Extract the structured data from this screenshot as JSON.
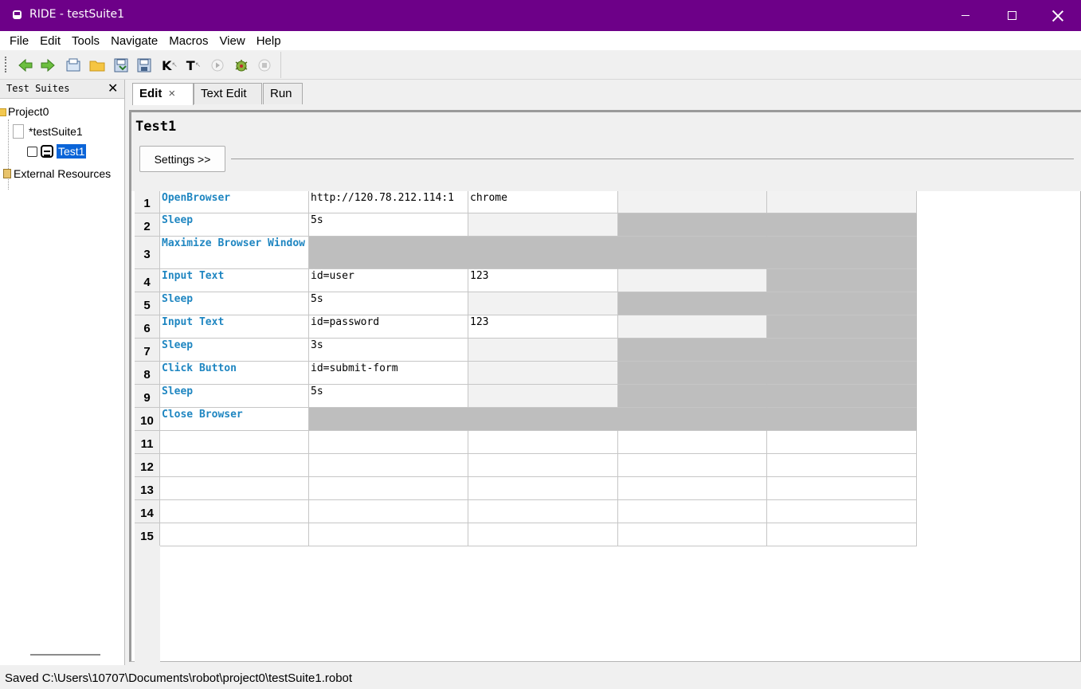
{
  "window": {
    "title": "RIDE - testSuite1"
  },
  "menu": [
    "File",
    "Edit",
    "Tools",
    "Navigate",
    "Macros",
    "View",
    "Help"
  ],
  "toolbar": {
    "k_label": "K",
    "t_label": "T"
  },
  "left_panel": {
    "header": "Test Suites",
    "close": "✕",
    "project": "Project0",
    "suite": "*testSuite1",
    "test": "Test1",
    "external": "External Resources"
  },
  "tabs": {
    "edit": "Edit",
    "edit_close": "×",
    "text_edit": "Text Edit",
    "run": "Run"
  },
  "editor": {
    "title": "Test1",
    "settings_button": "Settings >>"
  },
  "grid": {
    "rows": [
      {
        "num": "1",
        "keyword": "OpenBrowser",
        "args": [
          "http://120.78.212.114:1",
          "chrome",
          "",
          ""
        ],
        "shade": [
          "empty",
          "empty",
          "light",
          "light"
        ]
      },
      {
        "num": "2",
        "keyword": "Sleep",
        "args": [
          "5s",
          "",
          "",
          ""
        ],
        "shade": [
          "empty",
          "light",
          "dark",
          "dark"
        ]
      },
      {
        "num": "3",
        "keyword": "Maximize Browser Window",
        "args": [
          "",
          "",
          "",
          ""
        ],
        "shade": [
          "dark",
          "dark",
          "dark",
          "dark"
        ]
      },
      {
        "num": "4",
        "keyword": "Input Text",
        "args": [
          "id=user",
          "123",
          "",
          ""
        ],
        "shade": [
          "empty",
          "empty",
          "light",
          "dark"
        ]
      },
      {
        "num": "5",
        "keyword": "Sleep",
        "args": [
          "5s",
          "",
          "",
          ""
        ],
        "shade": [
          "empty",
          "light",
          "dark",
          "dark"
        ]
      },
      {
        "num": "6",
        "keyword": "Input Text",
        "args": [
          "id=password",
          "123",
          "",
          ""
        ],
        "shade": [
          "empty",
          "empty",
          "light",
          "dark"
        ]
      },
      {
        "num": "7",
        "keyword": "Sleep",
        "args": [
          "3s",
          "",
          "",
          ""
        ],
        "shade": [
          "empty",
          "light",
          "dark",
          "dark"
        ]
      },
      {
        "num": "8",
        "keyword": "Click Button",
        "args": [
          "id=submit-form",
          "",
          "",
          ""
        ],
        "shade": [
          "empty",
          "light",
          "dark",
          "dark"
        ]
      },
      {
        "num": "9",
        "keyword": "Sleep",
        "args": [
          "5s",
          "",
          "",
          ""
        ],
        "shade": [
          "empty",
          "light",
          "dark",
          "dark"
        ]
      },
      {
        "num": "10",
        "keyword": "Close Browser",
        "args": [
          "",
          "",
          "",
          ""
        ],
        "shade": [
          "dark",
          "dark",
          "dark",
          "dark"
        ]
      },
      {
        "num": "11",
        "keyword": "",
        "args": [
          "",
          "",
          "",
          ""
        ],
        "shade": [
          "empty",
          "empty",
          "empty",
          "empty"
        ]
      },
      {
        "num": "12",
        "keyword": "",
        "args": [
          "",
          "",
          "",
          ""
        ],
        "shade": [
          "empty",
          "empty",
          "empty",
          "empty"
        ]
      },
      {
        "num": "13",
        "keyword": "",
        "args": [
          "",
          "",
          "",
          ""
        ],
        "shade": [
          "empty",
          "empty",
          "empty",
          "empty"
        ]
      },
      {
        "num": "14",
        "keyword": "",
        "args": [
          "",
          "",
          "",
          ""
        ],
        "shade": [
          "empty",
          "empty",
          "empty",
          "empty"
        ]
      },
      {
        "num": "15",
        "keyword": "",
        "args": [
          "",
          "",
          "",
          ""
        ],
        "shade": [
          "empty",
          "empty",
          "empty",
          "empty"
        ]
      }
    ]
  },
  "status": {
    "text": "Saved C:\\Users\\10707\\Documents\\robot\\project0\\testSuite1.robot"
  },
  "icons": {
    "back": "back-arrow-icon",
    "forward": "forward-arrow-icon",
    "open": "open-suite-icon",
    "folder": "open-directory-icon",
    "save": "save-icon",
    "save_all": "save-all-icon",
    "search_keywords": "search-keywords-icon",
    "search_tests": "search-tests-icon",
    "run": "run-icon",
    "debug": "debug-icon",
    "stop": "stop-icon"
  },
  "colors": {
    "titlebar": "#6d0088",
    "keyword": "#1f86c1",
    "selection": "#0a64d8",
    "inactive_cell": "#bebebe"
  }
}
